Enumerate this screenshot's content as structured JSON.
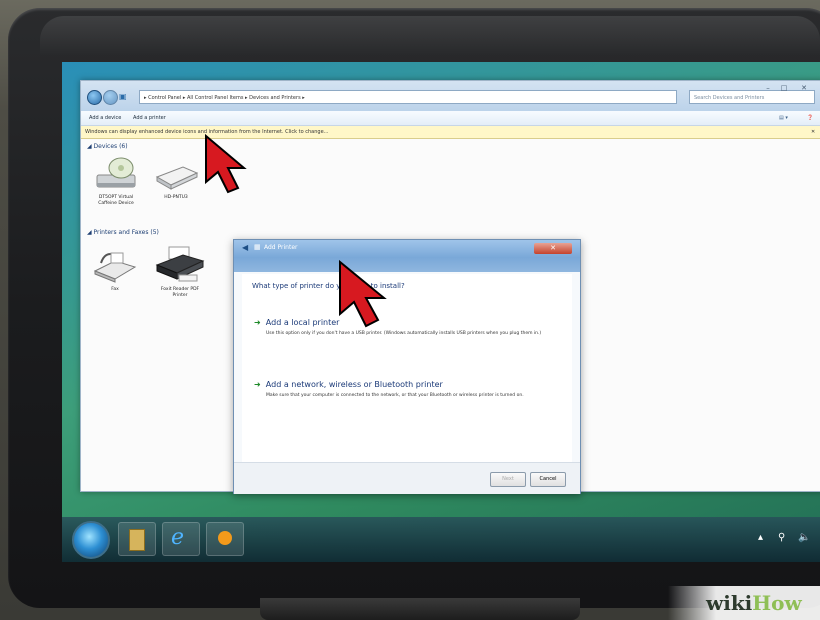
{
  "explorer": {
    "address_path": "▸ Control Panel ▸ All Control Panel Items ▸ Devices and Printers ▸",
    "search_placeholder": "Search Devices and Printers",
    "toolbar": {
      "add_device": "Add a device",
      "add_printer": "Add a printer"
    },
    "info_bar": "Windows can display enhanced device icons and information from the Internet. Click to change...",
    "devices_group": "Devices (6)",
    "devices": [
      {
        "label": "DT5OPT Virtual Caffeine Device",
        "icon": "optical-drive-icon"
      },
      {
        "label": "HD-PNTU3",
        "icon": "external-drive-icon"
      }
    ],
    "printers_group": "Printers and Faxes (5)",
    "printers": [
      {
        "label": "Fax",
        "icon": "fax-icon"
      },
      {
        "label": "Foxit Reader PDF Printer",
        "icon": "printer-icon"
      }
    ]
  },
  "dialog": {
    "title": "Add Printer",
    "question": "What type of printer do you want to install?",
    "option_local": "Add a local printer",
    "option_local_desc": "Use this option only if you don't have a USB printer. (Windows automatically installs USB printers when you plug them in.)",
    "option_network": "Add a network, wireless or Bluetooth printer",
    "option_network_desc": "Make sure that your computer is connected to the network, or that your Bluetooth or wireless printer is turned on.",
    "next_button": "Next",
    "cancel_button": "Cancel"
  },
  "watermark": {
    "wiki": "wiki",
    "how": "How"
  },
  "colors": {
    "cursor": "#d71920",
    "link_blue": "#1b3a78",
    "info_bar": "#fff7c8"
  }
}
